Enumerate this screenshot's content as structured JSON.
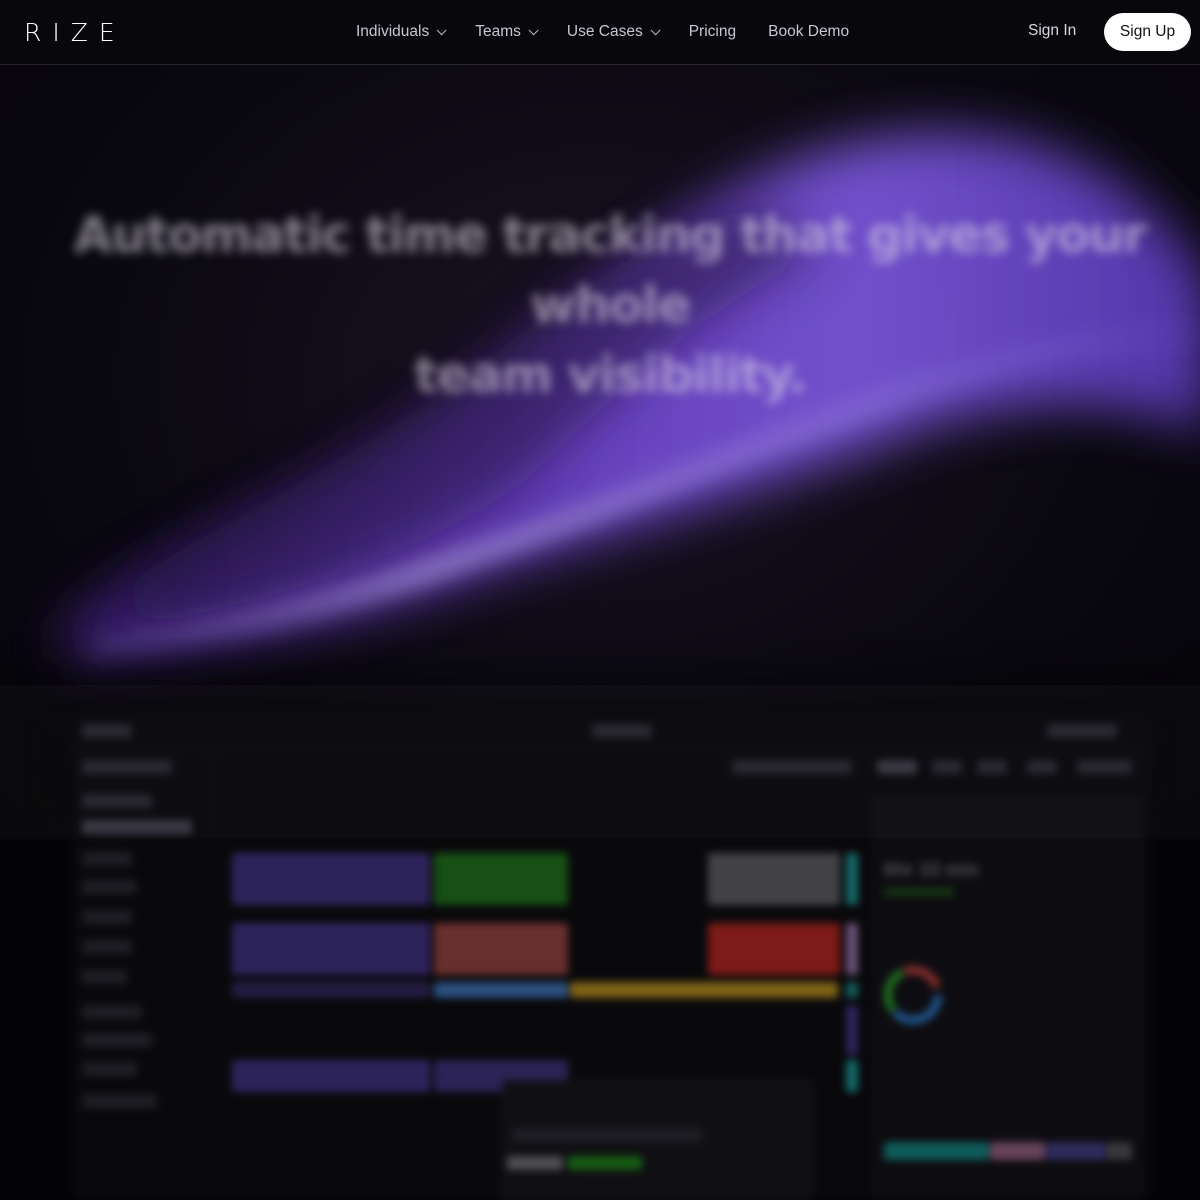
{
  "nav": {
    "logo": "RIZE",
    "links": [
      {
        "label": "Individuals",
        "has_dropdown": true
      },
      {
        "label": "Teams",
        "has_dropdown": true
      },
      {
        "label": "Use Cases",
        "has_dropdown": true
      },
      {
        "label": "Pricing",
        "has_dropdown": false
      },
      {
        "label": "Book Demo",
        "has_dropdown": false
      }
    ],
    "sign_in": "Sign In",
    "sign_up": "Sign Up"
  },
  "hero": {
    "title_line1": "Automatic time tracking that gives your whole",
    "title_line2": "team visibility."
  },
  "preview": {
    "total_time": "6hr 33 min"
  },
  "colors": {
    "accent_purple": "#7b4fe0",
    "background": "#050407",
    "nav_text": "#c9c6d2"
  }
}
